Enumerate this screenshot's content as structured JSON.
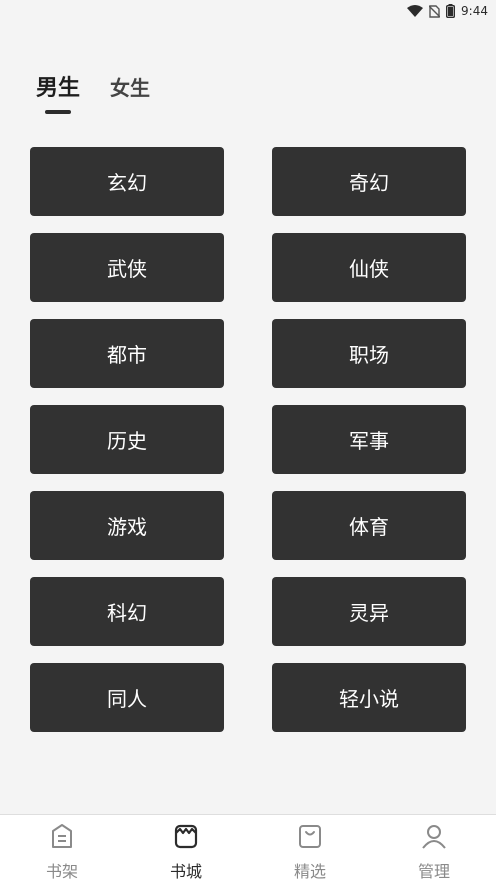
{
  "status_bar": {
    "time": "9:44",
    "icons": [
      "wifi-icon",
      "no-sim-icon",
      "battery-icon"
    ]
  },
  "gender_tabs": [
    {
      "label": "男生",
      "active": true
    },
    {
      "label": "女生",
      "active": false
    }
  ],
  "categories": [
    "玄幻",
    "奇幻",
    "武侠",
    "仙侠",
    "都市",
    "职场",
    "历史",
    "军事",
    "游戏",
    "体育",
    "科幻",
    "灵异",
    "同人",
    "轻小说"
  ],
  "bottom_nav": [
    {
      "label": "书架",
      "icon": "bookshelf-icon",
      "active": false
    },
    {
      "label": "书城",
      "icon": "bookstore-icon",
      "active": true
    },
    {
      "label": "精选",
      "icon": "featured-bag-icon",
      "active": false
    },
    {
      "label": "管理",
      "icon": "user-icon",
      "active": false
    }
  ],
  "colors": {
    "background": "#f4f4f4",
    "button": "#323232",
    "active_text": "#2c2c2c",
    "inactive_text": "#8a8a8a"
  }
}
